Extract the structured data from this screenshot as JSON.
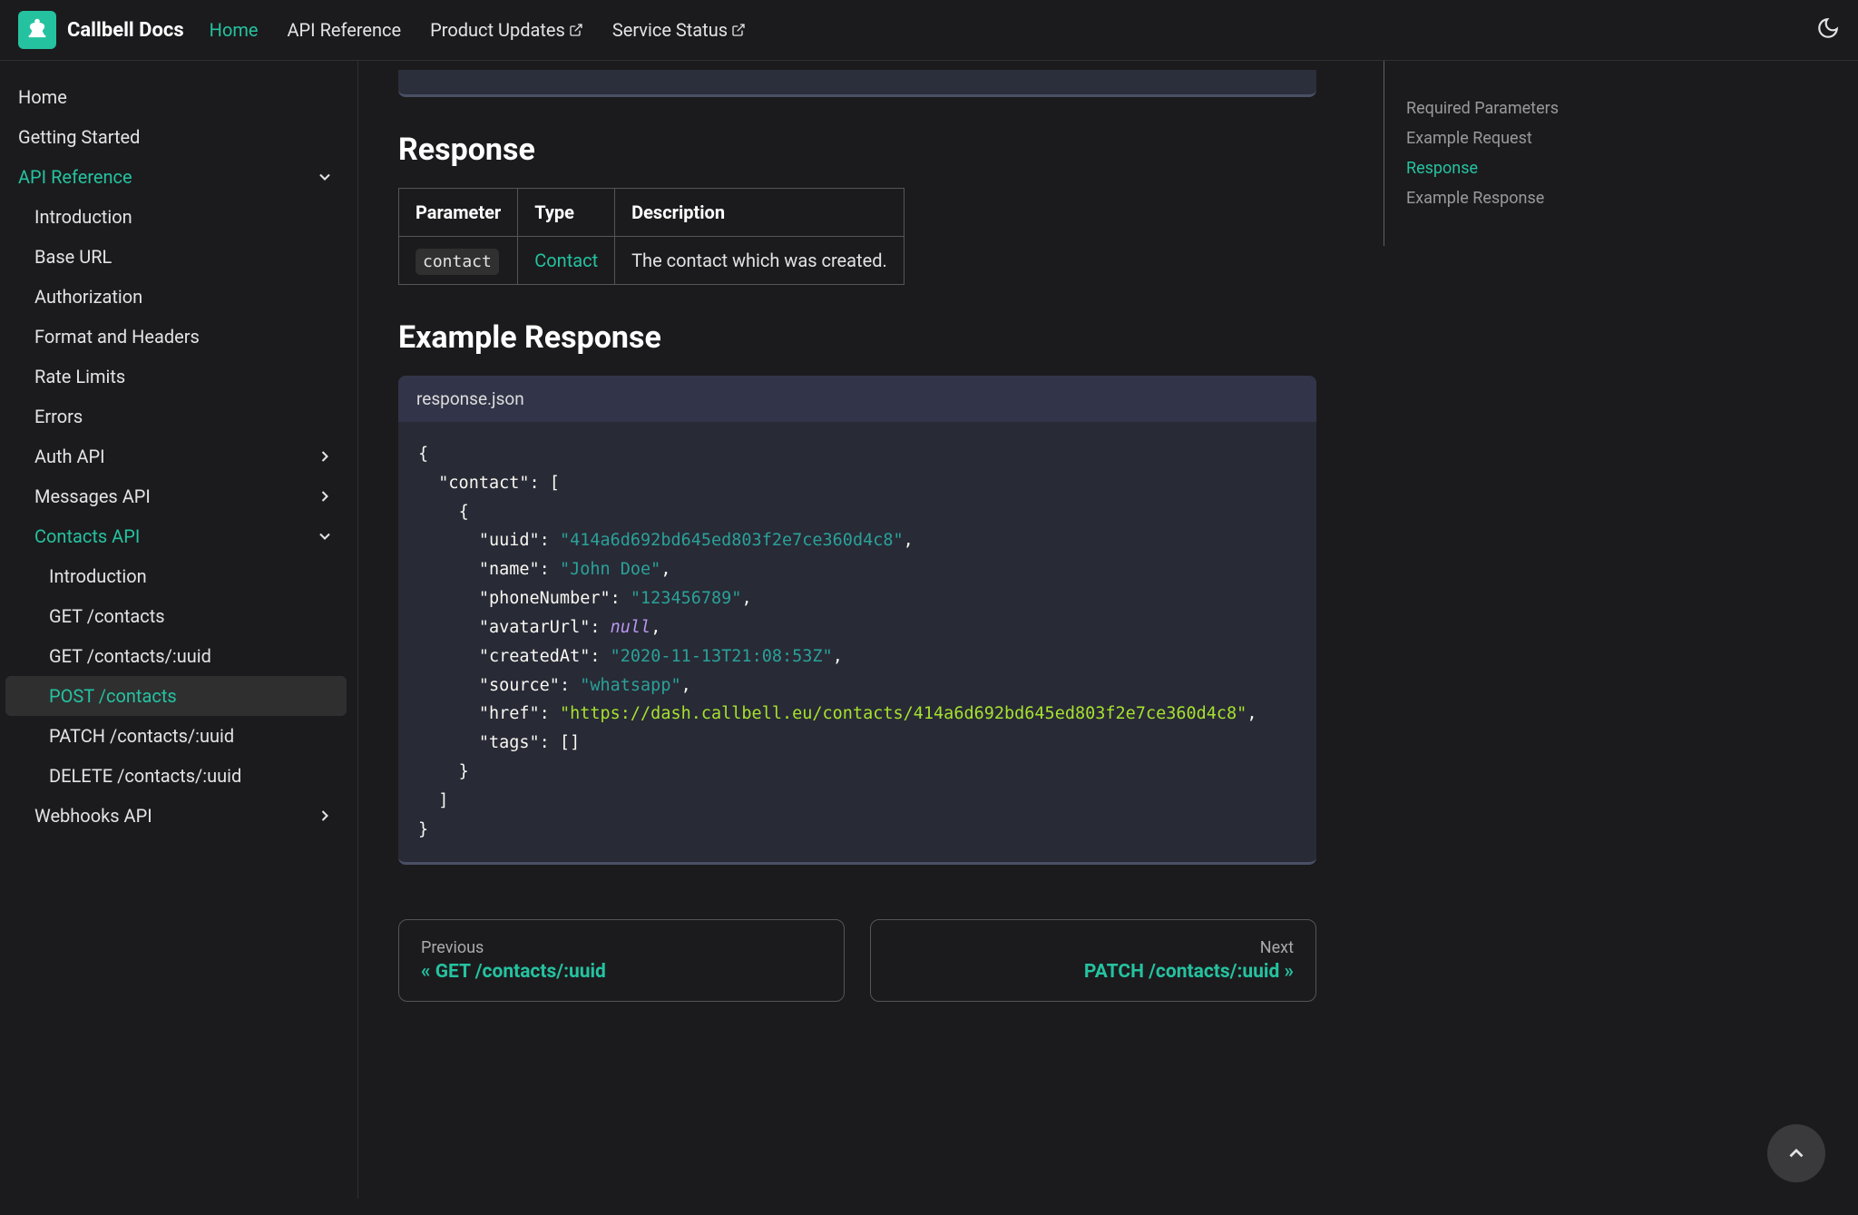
{
  "brand": "Callbell Docs",
  "nav": {
    "home": "Home",
    "api_ref": "API Reference",
    "product_updates": "Product Updates",
    "service_status": "Service Status"
  },
  "sidebar": {
    "home": "Home",
    "getting_started": "Getting Started",
    "api_reference": "API Reference",
    "introduction": "Introduction",
    "base_url": "Base URL",
    "authorization": "Authorization",
    "format_headers": "Format and Headers",
    "rate_limits": "Rate Limits",
    "errors": "Errors",
    "auth_api": "Auth API",
    "messages_api": "Messages API",
    "contacts_api": "Contacts API",
    "contacts_intro": "Introduction",
    "get_contacts": "GET /contacts",
    "get_contact_uuid": "GET /contacts/:uuid",
    "post_contacts": "POST /contacts",
    "patch_contacts": "PATCH /contacts/:uuid",
    "delete_contacts": "DELETE /contacts/:uuid",
    "webhooks_api": "Webhooks API"
  },
  "toc": {
    "required_params": "Required Parameters",
    "example_request": "Example Request",
    "response": "Response",
    "example_response": "Example Response"
  },
  "headings": {
    "response": "Response",
    "example_response": "Example Response"
  },
  "table": {
    "h_param": "Parameter",
    "h_type": "Type",
    "h_desc": "Description",
    "r_param": "contact",
    "r_type": "Contact",
    "r_desc": "The contact which was created."
  },
  "code": {
    "title": "response.json",
    "k_contact": "\"contact\"",
    "k_uuid": "\"uuid\"",
    "v_uuid": "\"414a6d692bd645ed803f2e7ce360d4c8\"",
    "k_name": "\"name\"",
    "v_name": "\"John Doe\"",
    "k_phone": "\"phoneNumber\"",
    "v_phone": "\"123456789\"",
    "k_avatar": "\"avatarUrl\"",
    "v_null": "null",
    "k_created": "\"createdAt\"",
    "v_created": "\"2020-11-13T21:08:53Z\"",
    "k_source": "\"source\"",
    "v_source": "\"whatsapp\"",
    "k_href": "\"href\"",
    "v_href": "\"https://dash.callbell.eu/contacts/414a6d692bd645ed803f2e7ce360d4c8\"",
    "k_tags": "\"tags\""
  },
  "prev": {
    "label": "Previous",
    "title": "« GET /contacts/:uuid"
  },
  "next": {
    "label": "Next",
    "title": "PATCH /contacts/:uuid »"
  }
}
